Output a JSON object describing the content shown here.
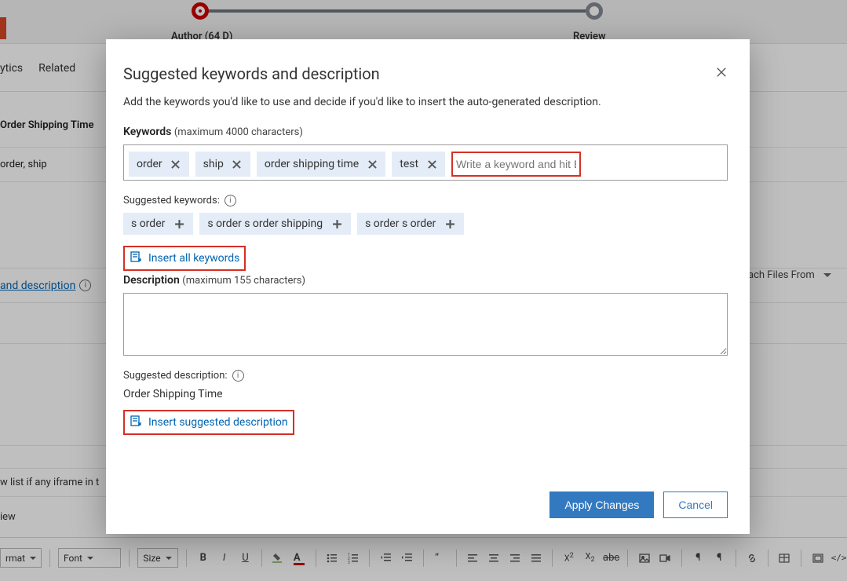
{
  "progress": {
    "author_label": "Author  (64 D)",
    "review_label": "Review"
  },
  "tabs": {
    "analytics": "ytics",
    "related": "Related"
  },
  "bg": {
    "title_label": "Order Shipping Time",
    "keywords_value": "order, ship",
    "suggested_link": "and description",
    "attach_label": "ach Files From",
    "iframe_msg": "w list if any iframe in t",
    "preview_label": "iew"
  },
  "toolbar": {
    "format": "rmat",
    "font": "Font",
    "size": "Size"
  },
  "modal": {
    "title": "Suggested keywords and description",
    "subtitle": "Add the keywords you'd like to use and decide if you'd like to insert the auto-generated description.",
    "keywords_label": "Keywords",
    "keywords_hint": "(maximum 4000 characters)",
    "kw_placeholder": "Write a keyword and hit Enter",
    "chips": [
      "order",
      "ship",
      "order shipping time",
      "test"
    ],
    "sugg_label": "Suggested keywords:",
    "sugg_chips": [
      "s order",
      "s order s order shipping",
      "s order s order"
    ],
    "insert_all": "Insert all keywords",
    "desc_label": "Description",
    "desc_hint": "(maximum 155 characters)",
    "sugg_desc_label": "Suggested description:",
    "sugg_desc_text": "Order Shipping Time",
    "insert_desc": "Insert suggested description",
    "apply": "Apply Changes",
    "cancel": "Cancel"
  }
}
